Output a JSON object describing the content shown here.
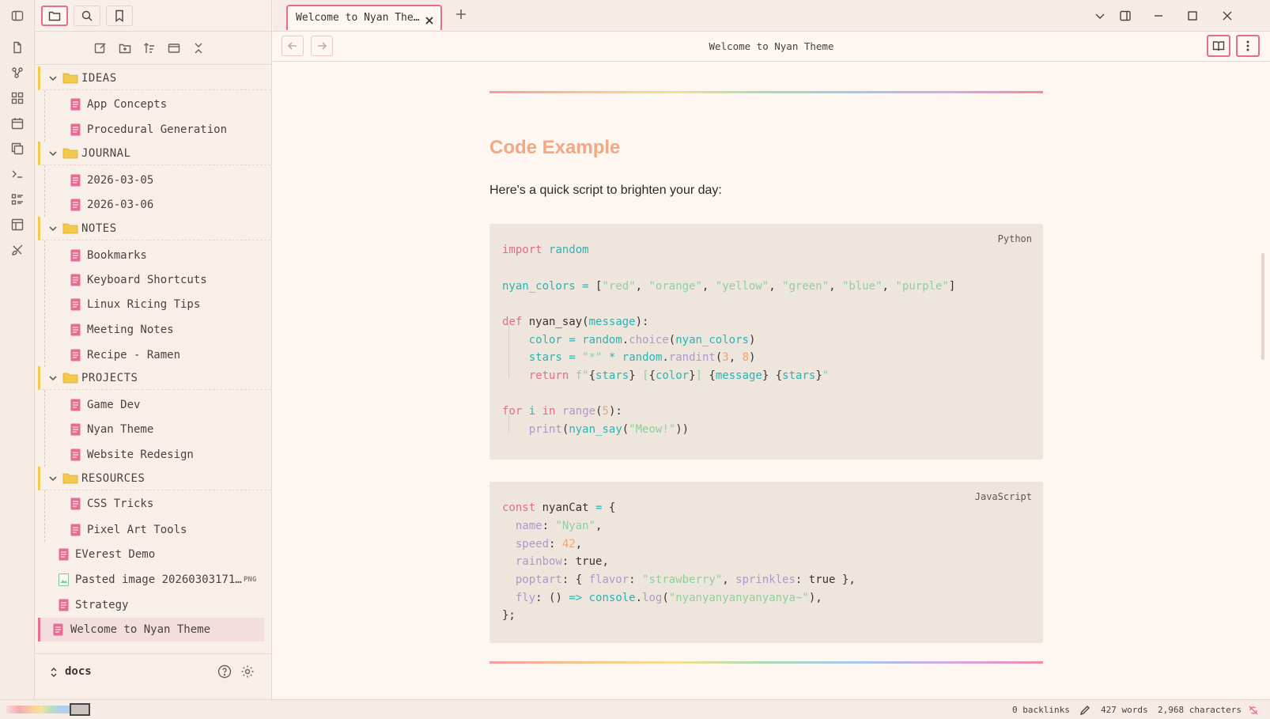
{
  "colors": {
    "accent": "#e86b93",
    "folder": "#f2c94c",
    "heading": "#f2a883",
    "file_icon": "#e86b93"
  },
  "ribbon": {
    "icons": [
      "new-note-icon",
      "graph-icon",
      "grid-icon",
      "calendar-icon",
      "copy-icon",
      "terminal-icon",
      "list-icon",
      "template-icon",
      "brush-icon"
    ]
  },
  "sidebar": {
    "tabs": [
      "files-tab",
      "search-tab",
      "bookmarks-tab"
    ],
    "actions": [
      "new-note",
      "new-folder",
      "sort",
      "collapse-view",
      "collapse-all"
    ],
    "folders": [
      {
        "label": "IDEAS",
        "files": [
          "App Concepts",
          "Procedural Generation"
        ]
      },
      {
        "label": "JOURNAL",
        "files": [
          "2026-03-05",
          "2026-03-06"
        ]
      },
      {
        "label": "NOTES",
        "files": [
          "Bookmarks",
          "Keyboard Shortcuts",
          "Linux Ricing Tips",
          "Meeting Notes",
          "Recipe - Ramen"
        ]
      },
      {
        "label": "PROJECTS",
        "files": [
          "Game Dev",
          "Nyan Theme",
          "Website Redesign"
        ]
      },
      {
        "label": "RESOURCES",
        "files": [
          "CSS Tricks",
          "Pixel Art Tools"
        ]
      }
    ],
    "root_files": [
      "EVerest Demo",
      "Pasted image 20260303171…",
      "Strategy",
      "Welcome to Nyan Theme"
    ],
    "png_badge": "PNG",
    "vault": "docs"
  },
  "tabbar": {
    "active_tab": "Welcome to Nyan The…"
  },
  "view": {
    "title": "Welcome to Nyan Theme"
  },
  "content": {
    "heading": "Code Example",
    "paragraph": "Here's a quick script to brighten your day:",
    "python_lang": "Python",
    "js_lang": "JavaScript"
  },
  "status": {
    "backlinks": "0 backlinks",
    "words": "427 words",
    "characters": "2,968 characters"
  }
}
